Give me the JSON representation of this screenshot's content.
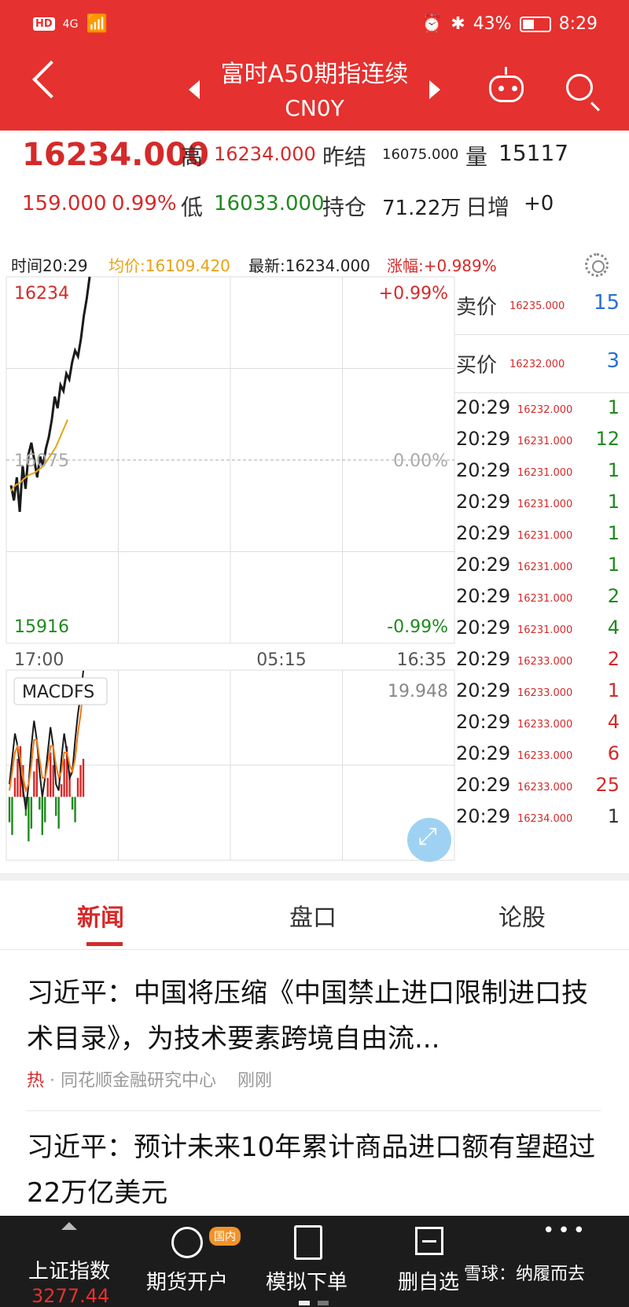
{
  "status_bar": {
    "hd": "HD",
    "signal": "4G",
    "battery": "43%",
    "time": "8:29"
  },
  "header": {
    "title": "富时A50期指连续",
    "subtitle": "CN0Y"
  },
  "quote": {
    "last": "16234.000",
    "high_label": "高",
    "high": "16234.000",
    "prev_close_label": "昨结",
    "prev_close": "16075.000",
    "volume_label": "量",
    "volume": "15117",
    "change": "159.000",
    "change_pct": "0.99%",
    "low_label": "低",
    "low": "16033.000",
    "oi_label": "持仓",
    "oi": "71.22万",
    "daily_inc_label": "日增",
    "daily_inc": "+0"
  },
  "legend": {
    "time": "时间20:29",
    "avg": "均价:16109.420",
    "latest": "最新:16234.000",
    "pct": "涨幅:+0.989%"
  },
  "chart_data": [
    {
      "type": "line",
      "title": "",
      "y_top_label": "16234",
      "y_mid_label": "16075",
      "y_bottom_label": "15916",
      "pct_top_label": "+0.99%",
      "pct_mid_label": "0.00%",
      "pct_bottom_label": "-0.99%",
      "x_labels": [
        "17:00",
        "05:15",
        "16:35"
      ],
      "ylim": [
        15916,
        16234
      ],
      "series": [
        {
          "values": [
            16053,
            16040,
            16060,
            16030,
            16070,
            16050,
            16080,
            16090,
            16075,
            16060,
            16078,
            16070,
            16085,
            16095,
            16110,
            16130,
            16120,
            16140,
            16135,
            16150,
            16145,
            16160,
            16170,
            16165,
            16180,
            16200,
            16215,
            16234
          ],
          "color": "#1a1a1a"
        },
        {
          "values": [
            16048,
            16052,
            16054,
            16055,
            16058,
            16060,
            16062,
            16063,
            16064,
            16066,
            16068,
            16070,
            16074,
            16078,
            16082,
            16086,
            16092,
            16098,
            16104,
            16110
          ],
          "color": "#e8a315"
        }
      ],
      "grid": true
    },
    {
      "type": "bar",
      "title": "",
      "indicator_label": "MACDFS",
      "top_value": "19.948",
      "bars": [
        -4,
        -6,
        3,
        6,
        8,
        5,
        -3,
        -7,
        -5,
        4,
        6,
        -2,
        -6,
        -4,
        3,
        7,
        5,
        -3,
        -5,
        2,
        6,
        8,
        4,
        -2,
        -4,
        3,
        5,
        6
      ],
      "line1": [
        2,
        6,
        10,
        8,
        4,
        1,
        -2,
        2,
        8,
        12,
        9,
        4,
        0,
        3,
        7,
        11,
        8,
        2,
        1,
        6,
        10,
        7,
        3,
        4,
        9,
        13,
        16,
        19.9
      ],
      "line2": [
        1,
        4,
        7,
        8,
        6,
        3,
        1,
        2,
        5,
        9,
        9,
        6,
        3,
        3,
        5,
        8,
        8,
        5,
        3,
        4,
        7,
        7,
        5,
        4,
        6,
        10,
        13,
        17
      ],
      "ylim": [
        -10,
        20
      ],
      "grid": true
    }
  ],
  "depth": {
    "ask_label": "卖价",
    "ask_price": "16235.000",
    "ask_vol": "15",
    "bid_label": "买价",
    "bid_price": "16232.000",
    "bid_vol": "3"
  },
  "ticks": [
    {
      "t": "20:29",
      "p": "16232.000",
      "v": "1",
      "c": "green"
    },
    {
      "t": "20:29",
      "p": "16231.000",
      "v": "12",
      "c": "green"
    },
    {
      "t": "20:29",
      "p": "16231.000",
      "v": "1",
      "c": "green"
    },
    {
      "t": "20:29",
      "p": "16231.000",
      "v": "1",
      "c": "green"
    },
    {
      "t": "20:29",
      "p": "16231.000",
      "v": "1",
      "c": "green"
    },
    {
      "t": "20:29",
      "p": "16231.000",
      "v": "1",
      "c": "green"
    },
    {
      "t": "20:29",
      "p": "16231.000",
      "v": "2",
      "c": "green"
    },
    {
      "t": "20:29",
      "p": "16231.000",
      "v": "4",
      "c": "green"
    },
    {
      "t": "20:29",
      "p": "16233.000",
      "v": "2",
      "c": "red"
    },
    {
      "t": "20:29",
      "p": "16233.000",
      "v": "1",
      "c": "red"
    },
    {
      "t": "20:29",
      "p": "16233.000",
      "v": "4",
      "c": "red"
    },
    {
      "t": "20:29",
      "p": "16233.000",
      "v": "6",
      "c": "red"
    },
    {
      "t": "20:29",
      "p": "16233.000",
      "v": "25",
      "c": "red"
    },
    {
      "t": "20:29",
      "p": "16234.000",
      "v": "1",
      "c": "dark"
    }
  ],
  "tabs": [
    "新闻",
    "盘口",
    "论股"
  ],
  "news": [
    {
      "headline": "习近平：中国将压缩《中国禁止进口限制进口技术目录》，为技术要素跨境自由流...",
      "hot": "热",
      "source": "同花顺金融研究中心",
      "time": "刚刚"
    },
    {
      "headline": "习近平：预计未来10年累计商品进口额有望超过22万亿美元"
    }
  ],
  "bottom_nav": {
    "index_label": "上证指数",
    "index_value": "3277.44",
    "futures_label": "期货开户",
    "futures_badge": "国内",
    "sim_label": "模拟下单",
    "delete_label": "删自选",
    "watermark": "雪球：纳履而去"
  },
  "colors": {
    "brand_red": "#e5312f",
    "up": "#d52a2a",
    "down": "#1f8a1f",
    "avg_line": "#e8a315"
  }
}
